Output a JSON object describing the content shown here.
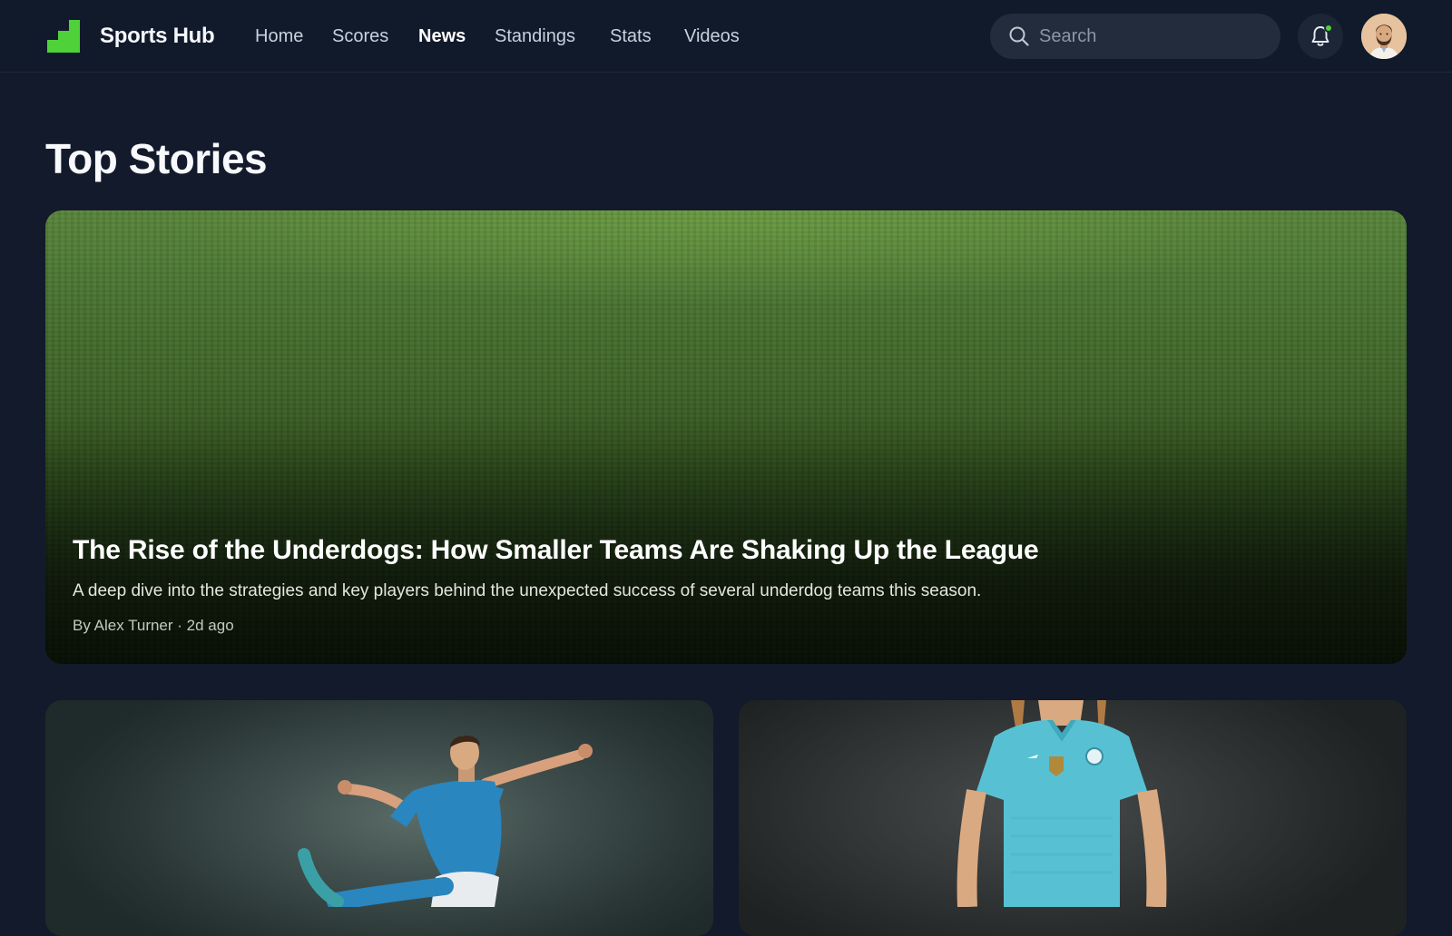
{
  "app": {
    "brand": "Sports Hub",
    "accent_color": "#4fd13a"
  },
  "nav": {
    "items": [
      {
        "label": "Home",
        "active": false
      },
      {
        "label": "Scores",
        "active": false
      },
      {
        "label": "News",
        "active": true
      },
      {
        "label": "Standings",
        "active": false
      },
      {
        "label": "Stats",
        "active": false
      },
      {
        "label": "Videos",
        "active": false
      }
    ]
  },
  "search": {
    "placeholder": "Search",
    "value": "",
    "icon": "search-icon"
  },
  "notifications": {
    "icon": "bell-icon",
    "has_unread": true
  },
  "user": {
    "avatar": "avatar"
  },
  "main": {
    "title": "Top Stories",
    "featured": {
      "title": "The Rise of the Underdogs: How Smaller Teams Are Shaking Up the League",
      "summary": "A deep dive into the strategies and key players behind the unexpected success of several underdog teams this season.",
      "meta": "By Alex Turner · 2d ago"
    }
  }
}
